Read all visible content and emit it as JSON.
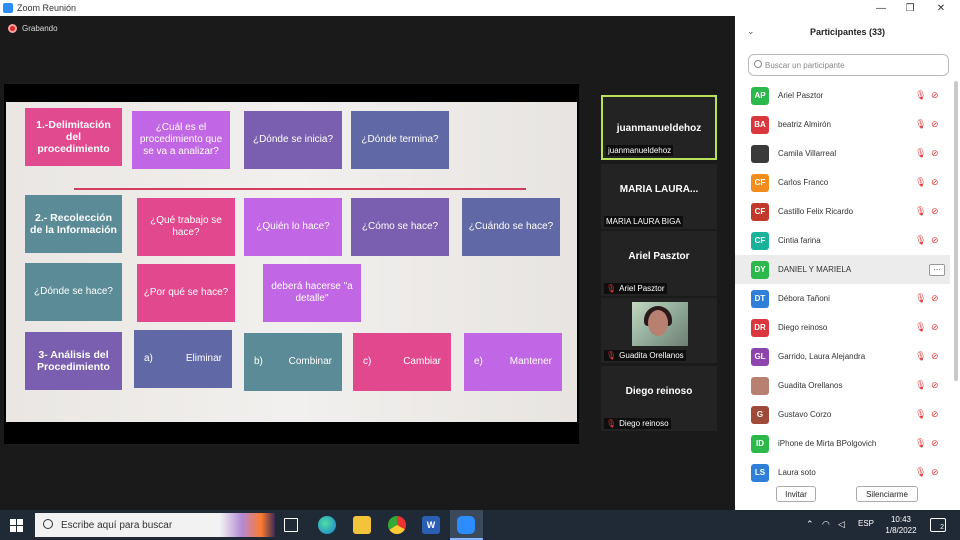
{
  "window": {
    "title": "Zoom Reunión",
    "minimize_glyph": "—",
    "restore_glyph": "❐",
    "close_glyph": "✕"
  },
  "recording": {
    "label": "Grabando"
  },
  "slide": {
    "row1": {
      "header": "1.-Delimitación del procedimiento",
      "q1": "¿Cuál es el procedimiento que se va a analizar?",
      "q2": "¿Dónde se inicia?",
      "q3": "¿Dónde termina?"
    },
    "row2": {
      "header": "2.- Recolección de la Información",
      "q1": "¿Qué trabajo se hace?",
      "q2": "¿Quién lo hace?",
      "q3": "¿Cómo se hace?",
      "q4": "¿Cuándo se hace?"
    },
    "row3": {
      "q1": "¿Dónde se hace?",
      "q2": "¿Por qué se hace?",
      "q3": "deberá hacerse \"a detalle\""
    },
    "row4": {
      "header": "3- Análisis del Procedimiento",
      "a_letter": "a)",
      "a_text": "Eliminar",
      "b_letter": "b)",
      "b_text": "Combinar",
      "c_letter": "c)",
      "c_text": "Cambiar",
      "e_letter": "e)",
      "e_text": "Mantener"
    }
  },
  "thumbnails": [
    {
      "name": "juanmanueldehoz",
      "label": "juanmanueldehoz",
      "muted": false
    },
    {
      "name": "MARIA LAURA...",
      "label": "MARIA LAURA BIGA",
      "muted": false
    },
    {
      "name": "Ariel Pasztor",
      "label": "Ariel Pasztor",
      "muted": true
    },
    {
      "name": "",
      "label": "Guadita Orellanos",
      "muted": true
    },
    {
      "name": "Diego reinoso",
      "label": "Diego reinoso",
      "muted": true
    }
  ],
  "participants": {
    "title": "Participantes (33)",
    "search_placeholder": "Buscar un participante",
    "list": [
      {
        "initials": "AP",
        "name": "Ariel Pasztor",
        "color": "#2db84c"
      },
      {
        "initials": "BA",
        "name": "beatriz Almirón",
        "color": "#d9363e"
      },
      {
        "initials": "",
        "name": "Camila Villarreal",
        "color": "#3a3a3a"
      },
      {
        "initials": "CF",
        "name": "Carlos Franco",
        "color": "#f28c1c"
      },
      {
        "initials": "CF",
        "name": "Castillo Felix Ricardo",
        "color": "#c0392b"
      },
      {
        "initials": "CF",
        "name": "Cintia farina",
        "color": "#1ab39a"
      },
      {
        "initials": "DY",
        "name": "DANIEL Y MARIELA",
        "color": "#2db84c"
      },
      {
        "initials": "DT",
        "name": "Débora Tañoni",
        "color": "#2f7fd8"
      },
      {
        "initials": "DR",
        "name": "Diego reinoso",
        "color": "#d9363e"
      },
      {
        "initials": "GL",
        "name": "Garrido, Laura Alejandra",
        "color": "#8e44ad"
      },
      {
        "initials": "",
        "name": "Guadita Orellanos",
        "color": "#b88070"
      },
      {
        "initials": "G",
        "name": "Gustavo Corzo",
        "color": "#a04a3a"
      },
      {
        "initials": "ID",
        "name": "iPhone de Mirta BPolgovich",
        "color": "#2db84c"
      },
      {
        "initials": "LS",
        "name": "Laura soto",
        "color": "#2f7fd8"
      }
    ],
    "more_label": "···",
    "invite_label": "Invitar",
    "mute_all_label": "Silenciarme"
  },
  "taskbar": {
    "search_placeholder": "Escribe aquí para buscar",
    "lang": "ESP",
    "time": "10:43",
    "date": "1/8/2022",
    "notifications": "2",
    "word_icon_letter": "W"
  },
  "colors": {
    "accent": "#2d8cff",
    "active_speaker": "#b8e05a",
    "muted_red": "#e03a3a"
  }
}
